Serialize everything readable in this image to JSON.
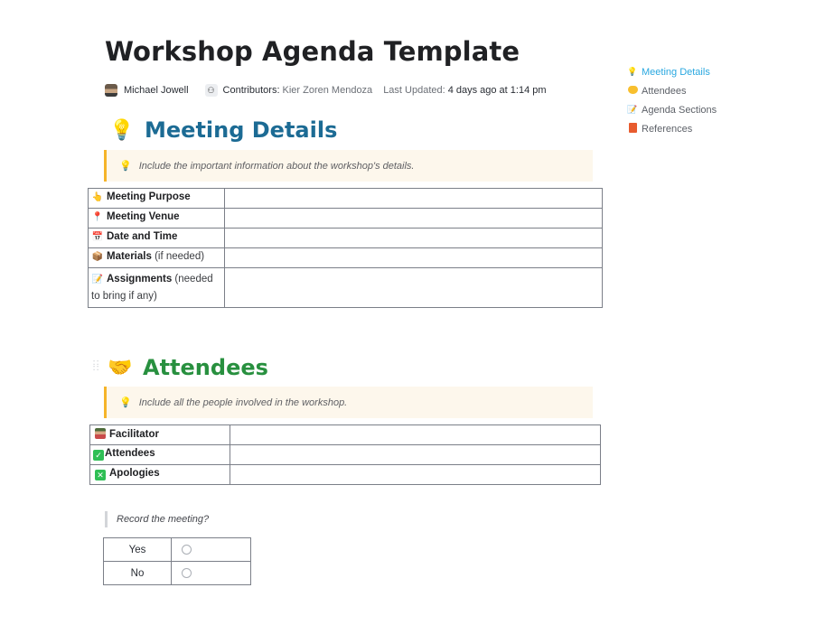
{
  "document": {
    "title": "Workshop Agenda Template",
    "author": "Michael Jowell",
    "contributors_label": "Contributors:",
    "contributors": "Kier Zoren Mendoza",
    "last_updated_label": "Last Updated:",
    "last_updated": "4 days ago at 1:14 pm"
  },
  "toc": [
    {
      "label": "Meeting Details",
      "icon": "lightbulb-icon",
      "active": true
    },
    {
      "label": "Attendees",
      "icon": "handshake-icon",
      "active": false
    },
    {
      "label": "Agenda Sections",
      "icon": "memo-icon",
      "active": false
    },
    {
      "label": "References",
      "icon": "book-icon",
      "active": false
    }
  ],
  "meeting_details": {
    "heading": "Meeting Details",
    "icon": "lightbulb-icon",
    "callout": "Include the important information about the workshop's details.",
    "rows": [
      {
        "icon": "pointing-up-icon",
        "label": "Meeting Purpose",
        "note": "",
        "value": ""
      },
      {
        "icon": "pushpin-icon",
        "label": "Meeting Venue",
        "note": "",
        "value": ""
      },
      {
        "icon": "calendar-icon",
        "label": "Date and Time",
        "note": "",
        "value": ""
      },
      {
        "icon": "package-icon",
        "label": "Materials",
        "note": "(if needed)",
        "value": ""
      },
      {
        "icon": "memo-icon",
        "label": "Assignments",
        "note": "(needed to bring if any)",
        "value": ""
      }
    ]
  },
  "attendees": {
    "heading": "Attendees",
    "icon": "handshake-icon",
    "callout": "Include all the people involved in the workshop.",
    "rows": [
      {
        "icon": "person-icon",
        "label": "Facilitator",
        "value": ""
      },
      {
        "icon": "check-box-icon",
        "label": "Attendees",
        "value": ""
      },
      {
        "icon": "cross-box-icon",
        "label": "Apologies",
        "value": ""
      }
    ]
  },
  "record": {
    "question": "Record the meeting?",
    "options": [
      {
        "label": "Yes",
        "selected": false
      },
      {
        "label": "No",
        "selected": false
      }
    ]
  }
}
